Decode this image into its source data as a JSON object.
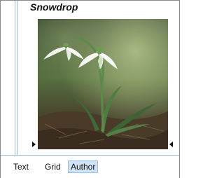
{
  "document": {
    "title": "Snowdrop"
  },
  "image": {
    "subject": "snowdrop-flower-photo"
  },
  "tabs": [
    {
      "label": "Text",
      "active": false
    },
    {
      "label": "Grid",
      "active": false
    },
    {
      "label": "Author",
      "active": true
    }
  ],
  "colors": {
    "border": "#8a8a8a",
    "divider": "#9db8d8",
    "active_tab_bg": "#cfe3f7",
    "active_tab_border": "#99c2ea"
  }
}
